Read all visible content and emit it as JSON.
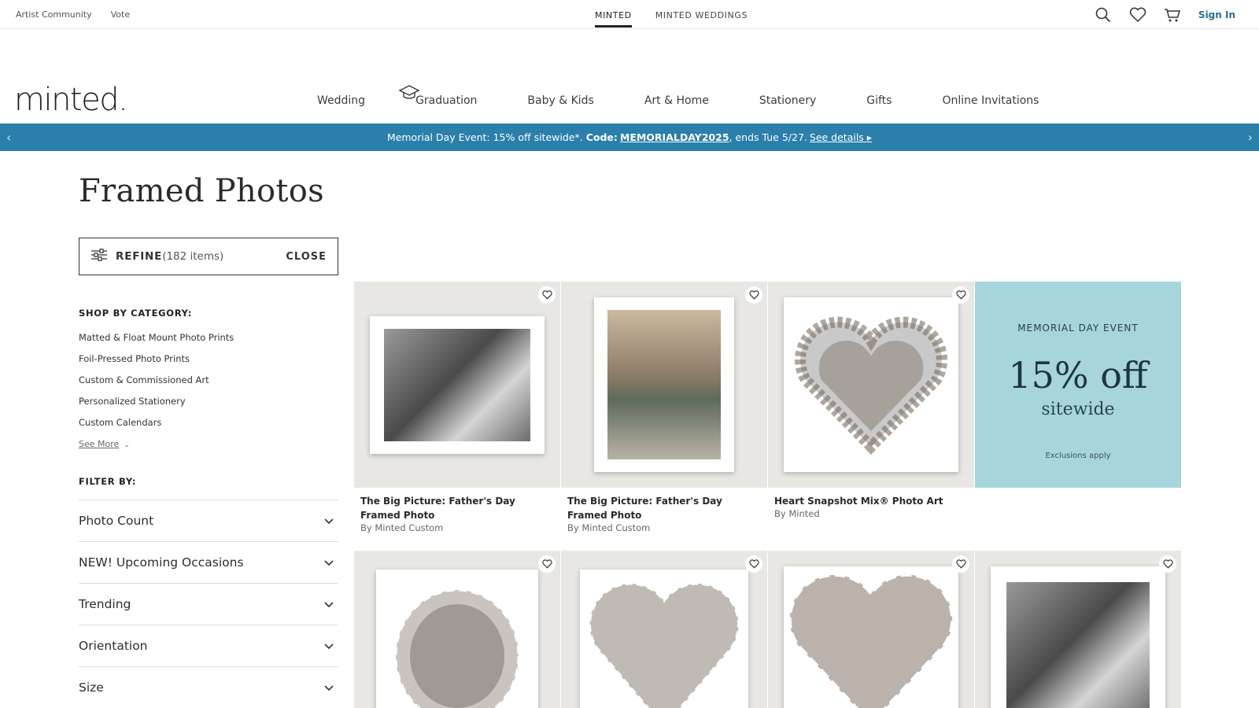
{
  "util": {
    "links": [
      "Artist Community",
      "Vote"
    ],
    "brand_tabs": [
      "MINTED",
      "MINTED WEDDINGS"
    ],
    "sign_in": "Sign In"
  },
  "logo": "minted.",
  "nav": [
    "Wedding",
    "Graduation",
    "Baby & Kids",
    "Art & Home",
    "Stationery",
    "Gifts",
    "Online Invitations"
  ],
  "promo": {
    "text": "Memorial Day Event: 15% off sitewide*.",
    "code_label": "Code:",
    "code": "MEMORIALDAY2025",
    "ends": ", ends Tue 5/27.",
    "details": "See details ▸",
    "prev": "‹",
    "next": "›"
  },
  "page_title": "Framed Photos",
  "refine": {
    "label": "REFINE",
    "count": "(182 items)",
    "close": "CLOSE"
  },
  "shop_by": {
    "heading": "SHOP BY CATEGORY:",
    "items": [
      "Matted & Float Mount Photo Prints",
      "Foil-Pressed Photo Prints",
      "Custom & Commissioned Art",
      "Personalized Stationery",
      "Custom Calendars"
    ],
    "see_more": "See More"
  },
  "filter_by": {
    "heading": "FILTER BY:",
    "items": [
      "Photo Count",
      "NEW! Upcoming Occasions",
      "Trending",
      "Orientation",
      "Size"
    ]
  },
  "products": [
    {
      "title": "The Big Picture: Father's Day Framed Photo",
      "by": "By Minted Custom"
    },
    {
      "title": "The Big Picture: Father's Day Framed Photo",
      "by": "By Minted Custom"
    },
    {
      "title": "Heart Snapshot Mix® Photo Art",
      "by": "By Minted"
    }
  ],
  "promo_tile": {
    "event": "MEMORIAL DAY EVENT",
    "big": "15% off",
    "sub": "sitewide",
    "excl": "Exclusions apply"
  },
  "colors": {
    "promo_bar": "#2a7fab",
    "promo_tile": "#a6d5dc",
    "tile_bg": "#e9e7e3"
  }
}
